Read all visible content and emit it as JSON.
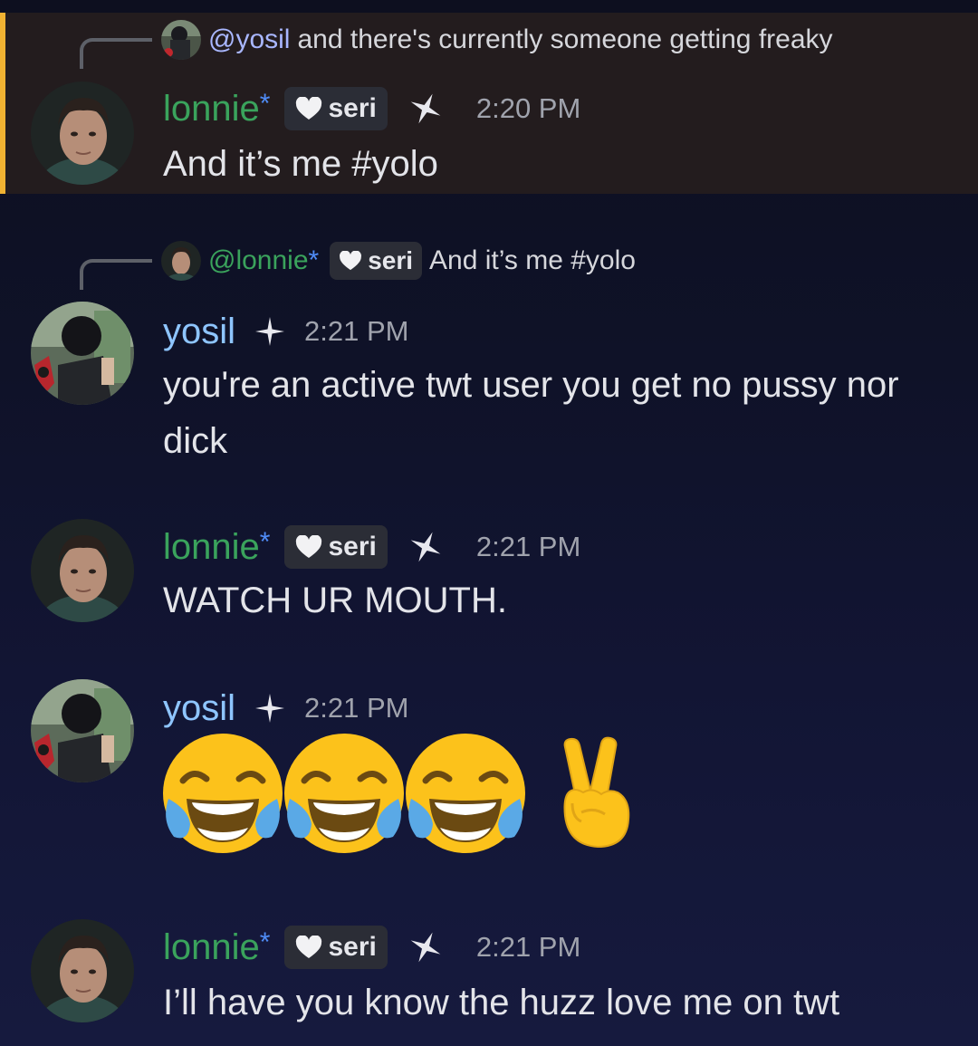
{
  "messages": [
    {
      "reply": {
        "mention": "@yosil",
        "text": "and there's currently someone getting freaky"
      },
      "author": "lonnie",
      "author_suffix": "*",
      "tag": "seri",
      "time": "2:20 PM",
      "text": "And it’s me #yolo",
      "highlighted": true
    },
    {
      "reply": {
        "mention": "@lonnie",
        "mention_suffix": "*",
        "tag": "seri",
        "text": "And it’s me #yolo"
      },
      "author": "yosil",
      "time": "2:21 PM",
      "text": "you're an active twt user you get no pussy nor dick"
    },
    {
      "author": "lonnie",
      "author_suffix": "*",
      "tag": "seri",
      "time": "2:21 PM",
      "text": "WATCH UR MOUTH."
    },
    {
      "author": "yosil",
      "time": "2:21 PM",
      "emojis": [
        "face-with-tears-of-joy",
        "face-with-tears-of-joy",
        "face-with-tears-of-joy",
        "victory-hand"
      ]
    },
    {
      "author": "lonnie",
      "author_suffix": "*",
      "tag": "seri",
      "time": "2:21 PM",
      "text": "I’ll have you know the huzz love me on twt"
    }
  ],
  "colors": {
    "highlight_bar": "#f0b232",
    "lonnie_name": "#3aa35c",
    "yosil_name": "#8ec5ff",
    "asterisk": "#4f8cf7"
  }
}
